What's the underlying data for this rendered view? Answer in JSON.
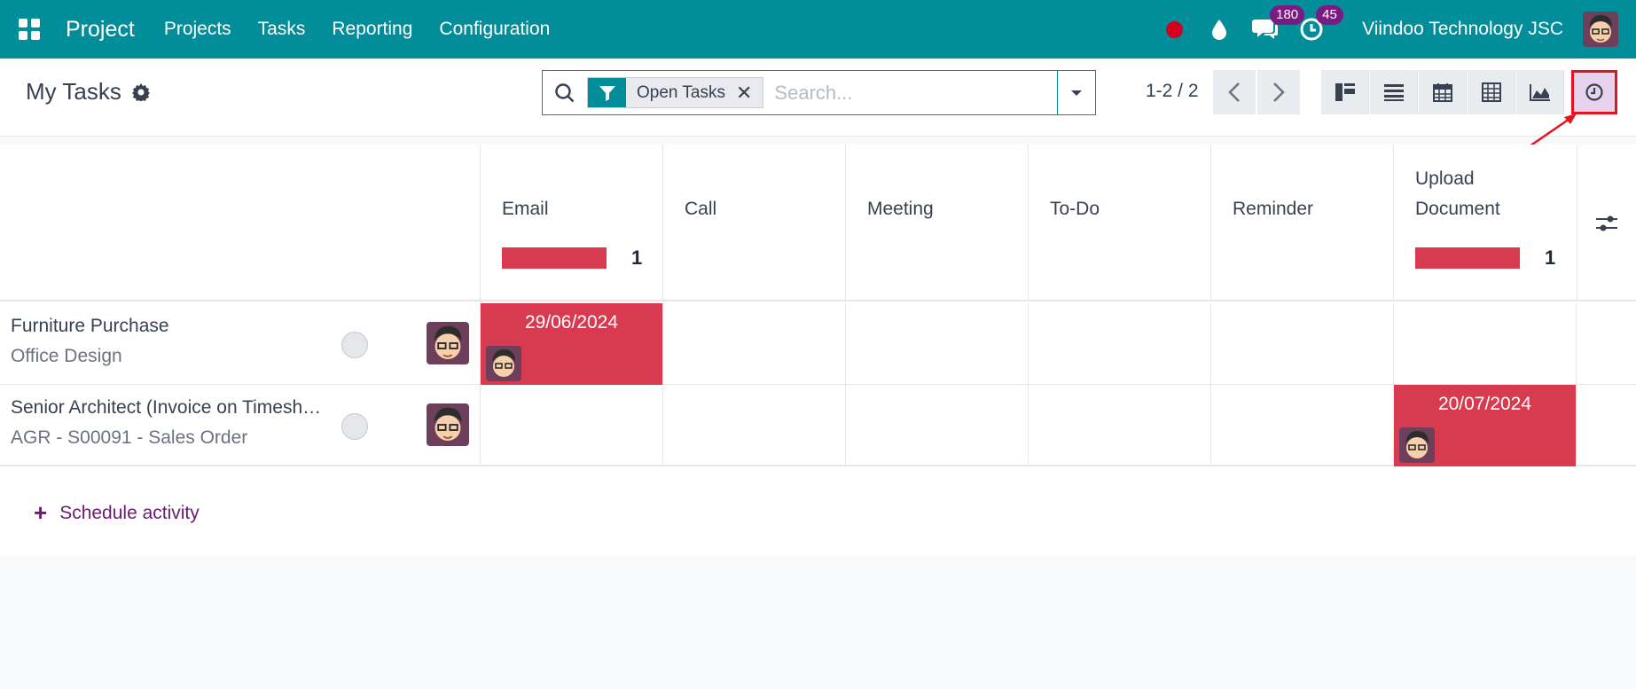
{
  "navbar": {
    "brand": "Project",
    "menu": [
      "Projects",
      "Tasks",
      "Reporting",
      "Configuration"
    ],
    "messages_badge": "180",
    "activities_badge": "45",
    "company": "Viindoo Technology JSC",
    "color": "#018d9a"
  },
  "control": {
    "title": "My Tasks",
    "facet_label": "Open Tasks",
    "search_placeholder": "Search...",
    "pager": "1-2 / 2",
    "views": [
      "kanban",
      "list",
      "calendar",
      "pivot",
      "graph",
      "activity"
    ],
    "active_view": "activity"
  },
  "columns": [
    {
      "name": "Email",
      "count": "1"
    },
    {
      "name": "Call",
      "count": ""
    },
    {
      "name": "Meeting",
      "count": ""
    },
    {
      "name": "To-Do",
      "count": ""
    },
    {
      "name": "Reminder",
      "count": ""
    },
    {
      "name": "Upload Document",
      "count": "1"
    }
  ],
  "rows": [
    {
      "title": "Furniture Purchase",
      "subtitle": "Office Design",
      "activity_column": 0,
      "date": "29/06/2024"
    },
    {
      "title": "Senior Architect (Invoice on Timesheets)",
      "subtitle": "AGR - S00091 - Sales Order",
      "activity_column": 5,
      "date": "20/07/2024"
    }
  ],
  "schedule": {
    "label": "Schedule activity"
  },
  "colors": {
    "overdue": "#d83a4f",
    "accent": "#018d9a",
    "link": "#6b1c6e",
    "badge": "#7a1a82"
  }
}
